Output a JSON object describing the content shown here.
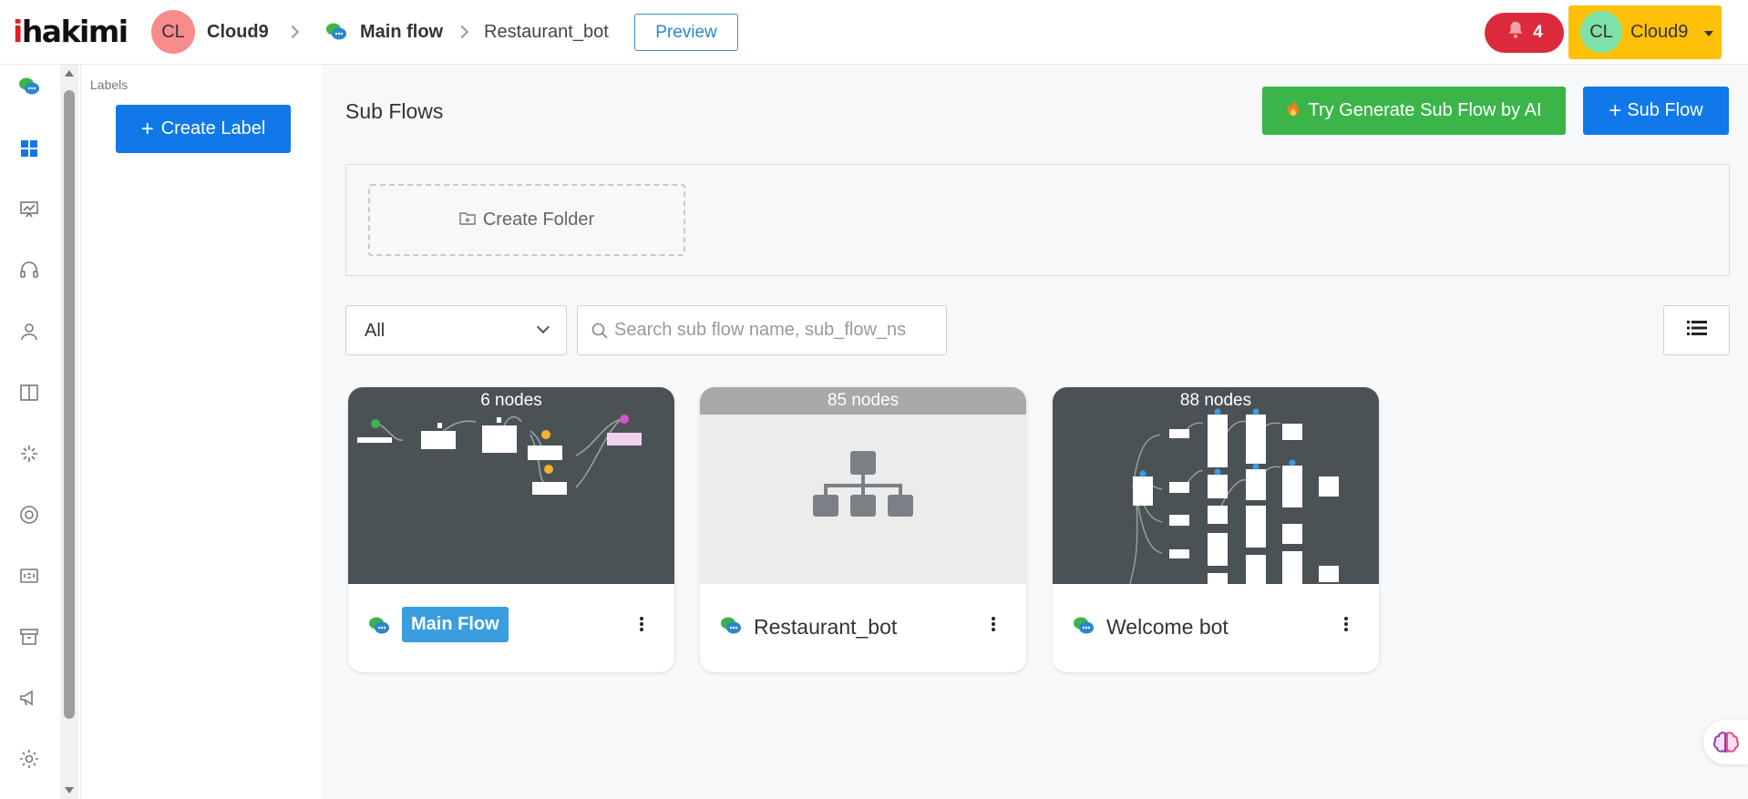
{
  "app": {
    "logo_text": "ihakimi",
    "brand_color": "#e31e24",
    "accent": "#1078e9"
  },
  "header": {
    "workspace_avatar": "CL",
    "workspace_name": "Cloud9",
    "breadcrumb_main": "Main flow",
    "breadcrumb_current": "Restaurant_bot",
    "preview_label": "Preview",
    "notification_count": "4",
    "user_avatar": "CL",
    "user_name": "Cloud9"
  },
  "sidebar": {
    "icons": [
      "chat-bot-icon",
      "dashboard-icon",
      "presentation-icon",
      "headset-icon",
      "user-icon",
      "book-icon",
      "sparkle-icon",
      "lifebuoy-icon",
      "id-card-icon",
      "archive-icon",
      "megaphone-icon",
      "settings-icon"
    ]
  },
  "labels": {
    "title": "Labels",
    "create_label": "Create Label"
  },
  "main": {
    "title": "Sub Flows",
    "ai_button": "Try Generate Sub Flow by AI",
    "subflow_button": "Sub Flow",
    "create_folder": "Create Folder",
    "filter_value": "All",
    "search_placeholder": "Search sub flow name, sub_flow_ns"
  },
  "cards": [
    {
      "nodes": "6 nodes",
      "name": "Main Flow",
      "thumb": "flow-preview"
    },
    {
      "nodes": "85 nodes",
      "name": "Restaurant_bot",
      "thumb": "placeholder"
    },
    {
      "nodes": "88 nodes",
      "name": "Welcome bot",
      "thumb": "flow-preview"
    }
  ]
}
